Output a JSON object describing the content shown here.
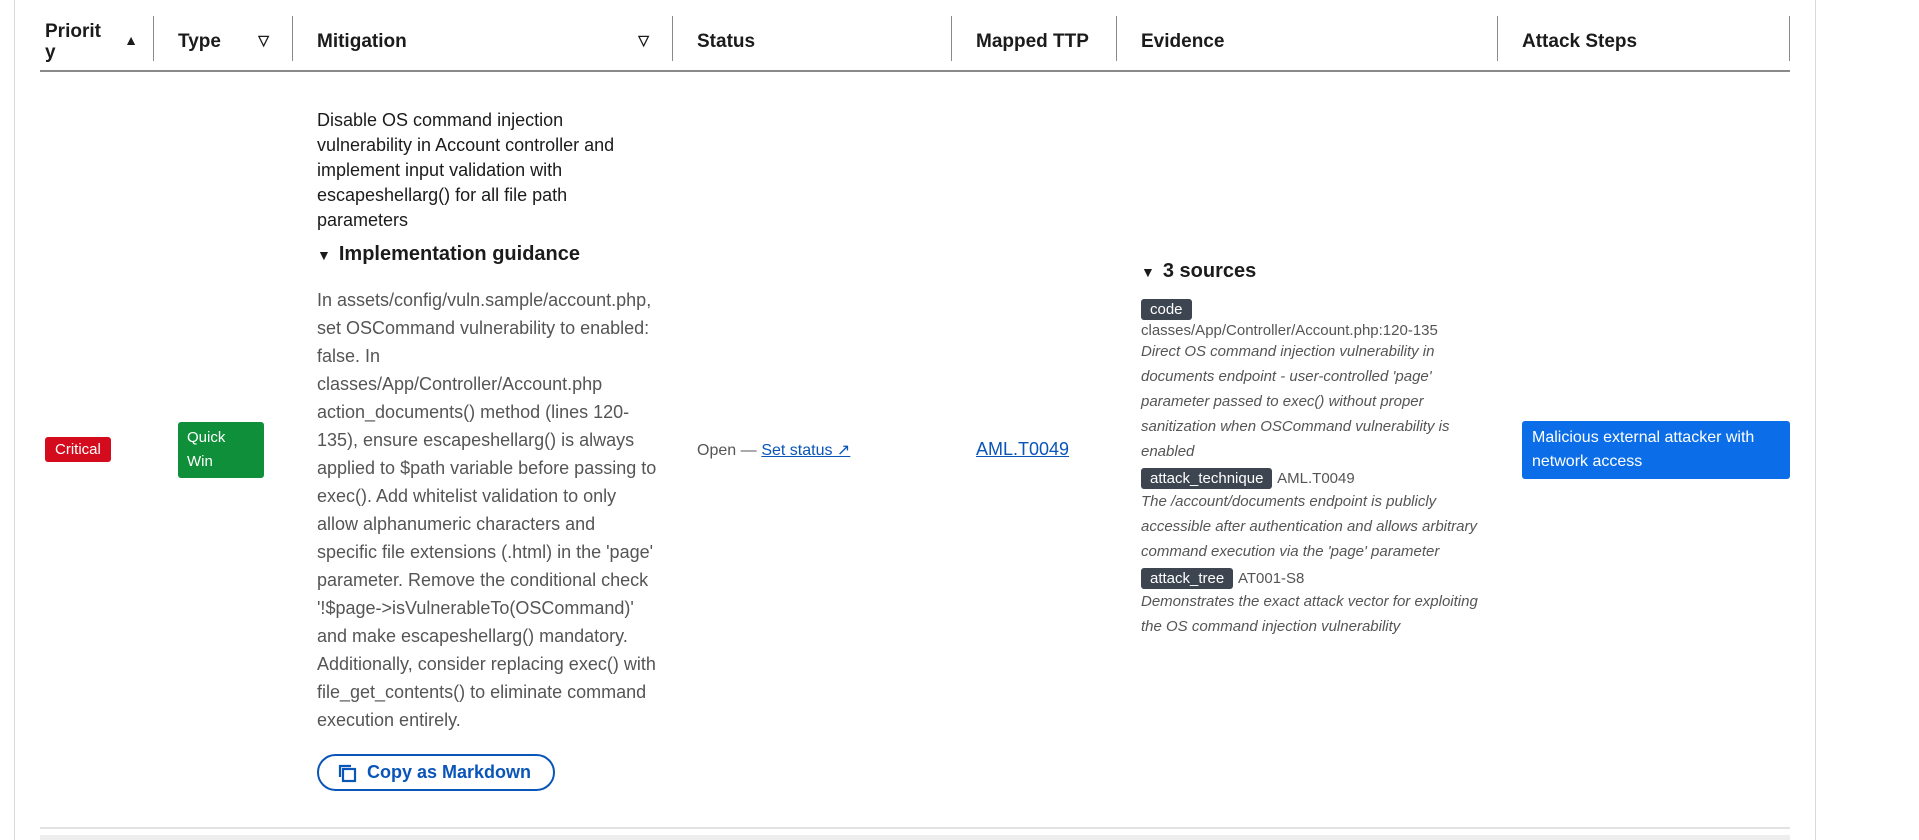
{
  "columns": {
    "priority": "Priority",
    "type": "Type",
    "mitigation": "Mitigation",
    "status": "Status",
    "mapped_ttp": "Mapped TTP",
    "evidence": "Evidence",
    "attack_steps": "Attack Steps"
  },
  "icons": {
    "sort": "sort-ascending-icon",
    "filter": "filter-icon",
    "details_open": "triangle-down-icon",
    "copy": "copy-icon"
  },
  "row": {
    "priority": "Critical",
    "type": "Quick Win",
    "mitigation": "Disable OS command injection vulnerability in Account controller and implement input validation with escapeshellarg() for all file path parameters",
    "guidance_summary": "Implementation guidance",
    "guidance_text": "In assets/config/vuln.sample/account.php, set OSCommand vulnerability to enabled: false. In classes/App/Controller/Account.php action_documents() method (lines 120-135), ensure escapeshellarg() is always applied to $path variable before passing to exec(). Add whitelist validation to only allow alphanumeric characters and specific file extensions (.html) in the 'page' parameter. Remove the conditional check '!$page->isVulnerableTo(OSCommand)' and make escapeshellarg() mandatory. Additionally, consider replacing exec() with file_get_contents() to eliminate command execution entirely.",
    "copy_label": "Copy as Markdown",
    "status": "Open —",
    "set_status": "Set status ↗",
    "ttp": "AML.T0049",
    "evidence_summary": "3 sources",
    "evidence": [
      {
        "tag": "code",
        "meta": "classes/App/Controller/Account.php:120-135",
        "desc": "Direct OS command injection vulnerability in documents endpoint - user-controlled 'page' parameter passed to exec() without proper sanitization when OSCommand vulnerability is enabled"
      },
      {
        "tag": "attack_technique",
        "meta": "AML.T0049",
        "desc": "The /account/documents endpoint is publicly accessible after authentication and allows arbitrary command execution via the 'page' parameter"
      },
      {
        "tag": "attack_tree",
        "meta": "AT001-S8",
        "desc": "Demonstrates the exact attack vector for exploiting the OS command injection vulnerability"
      }
    ],
    "attack_step": "Malicious external attacker with network access"
  },
  "colors": {
    "critical": "#d40b1c",
    "quick_win": "#108f3a",
    "link": "#0a55b8",
    "tag": "#3d4551",
    "attack_step": "#0b6ee8"
  }
}
